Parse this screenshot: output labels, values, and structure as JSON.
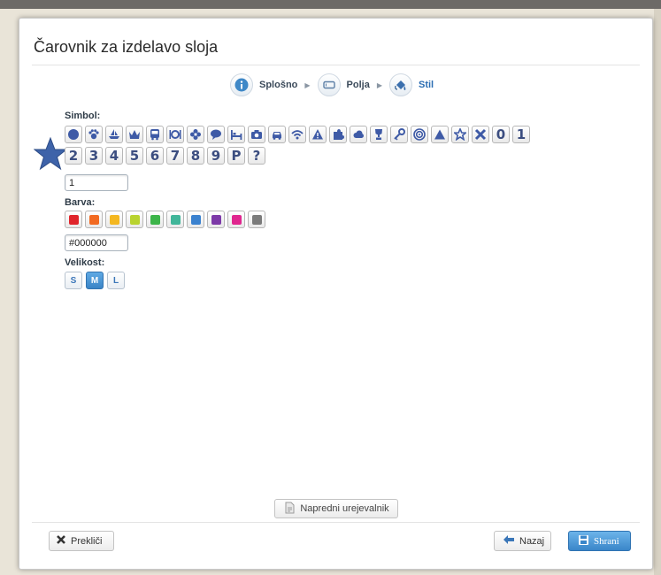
{
  "dialog": {
    "title": "Čarovnik za izdelavo sloja"
  },
  "steps": [
    {
      "label": "Splošno",
      "icon": "info-icon",
      "active": false
    },
    {
      "label": "Polja",
      "icon": "field-icon",
      "active": false
    },
    {
      "label": "Stil",
      "icon": "paint-bucket-icon",
      "active": true
    }
  ],
  "symbol": {
    "label": "Simbol:",
    "value": "1",
    "preview_icon": "star-icon",
    "row1_icons": [
      "circle-icon",
      "paw-icon",
      "boat-icon",
      "crown-icon",
      "bus-icon",
      "plate-icon",
      "flower-icon",
      "speech-icon",
      "bed-icon",
      "camera-icon",
      "car-icon",
      "wifi-icon",
      "warning-icon",
      "puzzle-icon",
      "cloud-icon",
      "trophy-icon",
      "key-icon",
      "target-icon",
      "triangle-icon",
      "star-icon",
      "x-icon"
    ],
    "row1_numbers": [
      "0",
      "1"
    ],
    "row2_numbers": [
      "2",
      "3",
      "4",
      "5",
      "6",
      "7",
      "8",
      "9",
      "P",
      "?"
    ]
  },
  "color": {
    "label": "Barva:",
    "value": "#000000",
    "swatches": [
      "#e0252b",
      "#f26a22",
      "#f4b720",
      "#b9d32f",
      "#3db54a",
      "#41b69a",
      "#3b82cf",
      "#7d3aa8",
      "#e0268f",
      "#7b7b7b"
    ]
  },
  "size": {
    "label": "Velikost:",
    "options": [
      "S",
      "M",
      "L"
    ],
    "selected": "M"
  },
  "advanced_button": "Napredni urejevalnik",
  "footer": {
    "cancel": "Prekliči",
    "back": "Nazaj",
    "save": "Shrani"
  }
}
